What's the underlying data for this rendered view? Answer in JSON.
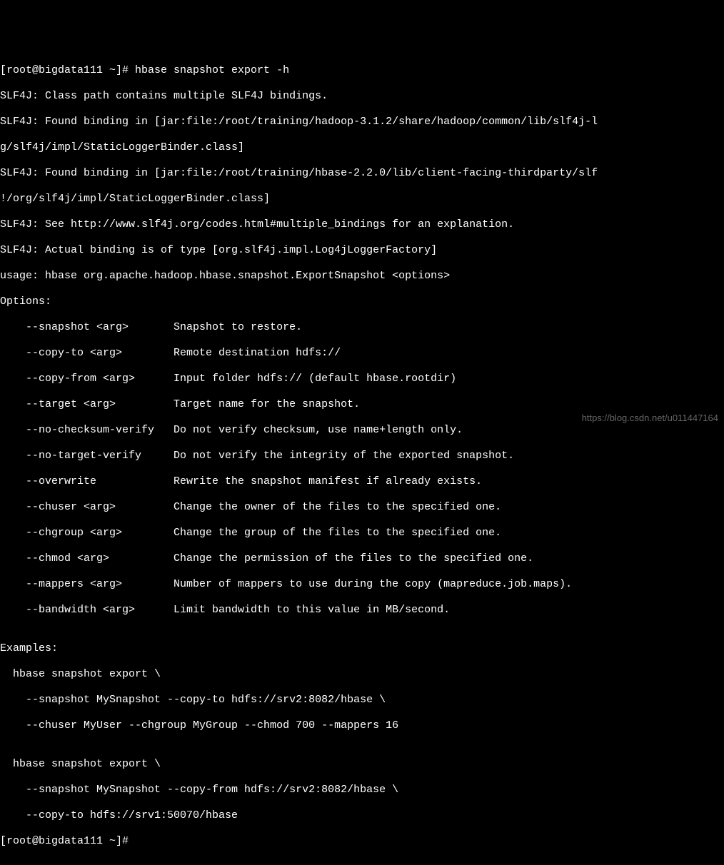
{
  "lines": [
    "[root@bigdata111 ~]# hbase snapshot export -h",
    "SLF4J: Class path contains multiple SLF4J bindings.",
    "SLF4J: Found binding in [jar:file:/root/training/hadoop-3.1.2/share/hadoop/common/lib/slf4j-l",
    "g/slf4j/impl/StaticLoggerBinder.class]",
    "SLF4J: Found binding in [jar:file:/root/training/hbase-2.2.0/lib/client-facing-thirdparty/slf",
    "!/org/slf4j/impl/StaticLoggerBinder.class]",
    "SLF4J: See http://www.slf4j.org/codes.html#multiple_bindings for an explanation.",
    "SLF4J: Actual binding is of type [org.slf4j.impl.Log4jLoggerFactory]",
    "usage: hbase org.apache.hadoop.hbase.snapshot.ExportSnapshot <options>",
    "Options:",
    "    --snapshot <arg>       Snapshot to restore.",
    "    --copy-to <arg>        Remote destination hdfs://",
    "    --copy-from <arg>      Input folder hdfs:// (default hbase.rootdir)",
    "    --target <arg>         Target name for the snapshot.",
    "    --no-checksum-verify   Do not verify checksum, use name+length only.",
    "    --no-target-verify     Do not verify the integrity of the exported snapshot.",
    "    --overwrite            Rewrite the snapshot manifest if already exists.",
    "    --chuser <arg>         Change the owner of the files to the specified one.",
    "    --chgroup <arg>        Change the group of the files to the specified one.",
    "    --chmod <arg>          Change the permission of the files to the specified one.",
    "    --mappers <arg>        Number of mappers to use during the copy (mapreduce.job.maps).",
    "    --bandwidth <arg>      Limit bandwidth to this value in MB/second.",
    "",
    "Examples:",
    "  hbase snapshot export \\",
    "    --snapshot MySnapshot --copy-to hdfs://srv2:8082/hbase \\",
    "    --chuser MyUser --chgroup MyGroup --chmod 700 --mappers 16",
    "",
    "  hbase snapshot export \\",
    "    --snapshot MySnapshot --copy-from hdfs://srv2:8082/hbase \\",
    "    --copy-to hdfs://srv1:50070/hbase",
    "[root@bigdata111 ~]#"
  ],
  "watermark": "https://blog.csdn.net/u011447164"
}
